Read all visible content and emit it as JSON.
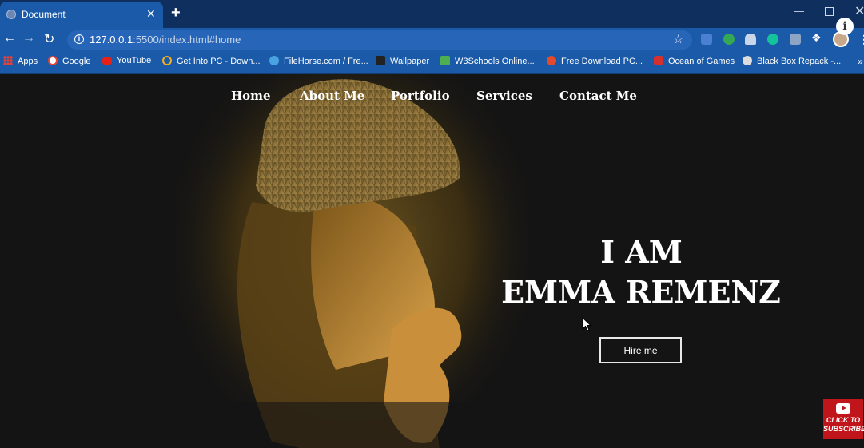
{
  "browser": {
    "tab_title": "Document",
    "tab_close": "✕",
    "new_tab": "+",
    "window_min": "—",
    "window_close": "✕",
    "url_host": "127.0.0.1",
    "url_path": ":5500/index.html#home",
    "info_badge": "i",
    "bookmarks": [
      {
        "label": "Apps",
        "icon": "apps-grid-icon"
      },
      {
        "label": "Google",
        "icon": "google-icon",
        "color": "#ffffff"
      },
      {
        "label": "YouTube",
        "icon": "youtube-icon",
        "color": "#e62117"
      },
      {
        "label": "Get Into PC - Down...",
        "icon": "getintopc-icon",
        "color": "#f2b01e"
      },
      {
        "label": "FileHorse.com / Fre...",
        "icon": "filehorse-icon",
        "color": "#4aa3e0"
      },
      {
        "label": "Wallpaper",
        "icon": "wallpaper-icon",
        "color": "#222222"
      },
      {
        "label": "W3Schools Online...",
        "icon": "w3schools-icon",
        "color": "#4caf50"
      },
      {
        "label": "Free Download PC...",
        "icon": "freedownload-icon",
        "color": "#e34a2d"
      },
      {
        "label": "Ocean of Games",
        "icon": "oceanofgames-icon",
        "color": "#d3302f"
      },
      {
        "label": "Black Box Repack -...",
        "icon": "blackbox-icon",
        "color": "#dddddd"
      }
    ],
    "bookmarks_more": "»"
  },
  "site": {
    "nav": [
      "Home",
      "About Me",
      "Portfolio",
      "Services",
      "Contact Me"
    ],
    "hero_line1": "I AM",
    "hero_line2": "EMMA REMENZ",
    "hire_button": "Hire me"
  },
  "overlay": {
    "subscribe_line1": "CLICK TO",
    "subscribe_line2": "SUBSCRIBE"
  },
  "colors": {
    "chrome_dark": "#0f2f5e",
    "chrome_blue": "#1b5aa8",
    "page_bg": "#141414",
    "subscribe_red": "#c0161b"
  }
}
